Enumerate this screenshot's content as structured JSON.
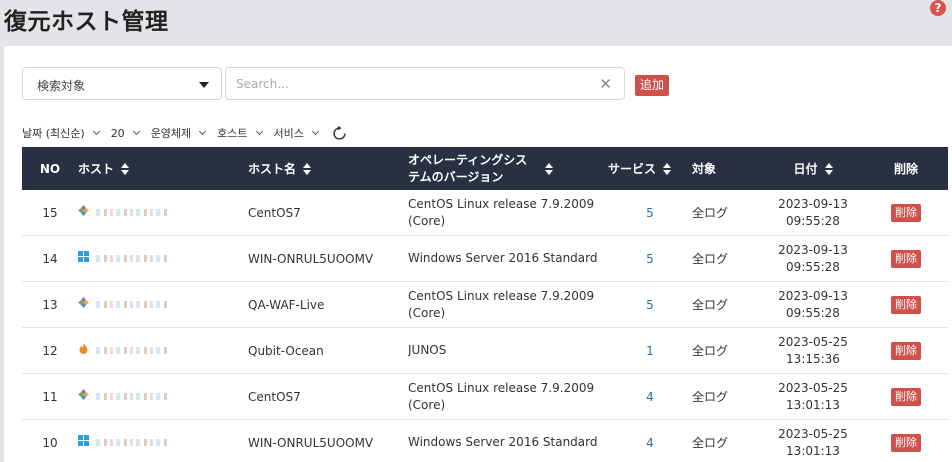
{
  "header": {
    "title": "復元ホスト管理",
    "help_icon": "question-circle-icon"
  },
  "toolbar": {
    "search_target_label": "検索対象",
    "search_placeholder": "Search...",
    "add_label": "追加"
  },
  "filters": [
    "날짜 (최신순)",
    "20",
    "운영체제",
    "호스트",
    "서비스"
  ],
  "table": {
    "headers": {
      "no": "NO",
      "host": "ホスト",
      "host_name": "ホスト名",
      "os": "オペレーティングシステムのバージョン",
      "services": "サービス",
      "target": "対象",
      "date": "日付",
      "delete": "削除"
    },
    "rows": [
      {
        "no": "15",
        "os_icon": "linux-icon",
        "host_name": "CentOS7",
        "os": "CentOS Linux release 7.9.2009 (Core)",
        "services": "5",
        "target": "全ログ",
        "date": "2023-09-13",
        "time": "09:55:28",
        "delete": "削除"
      },
      {
        "no": "14",
        "os_icon": "windows-icon",
        "host_name": "WIN-ONRUL5UOOMV",
        "os": "Windows Server 2016 Standard",
        "services": "5",
        "target": "全ログ",
        "date": "2023-09-13",
        "time": "09:55:28",
        "delete": "削除"
      },
      {
        "no": "13",
        "os_icon": "linux-icon",
        "host_name": "QA-WAF-Live",
        "os": "CentOS Linux release 7.9.2009 (Core)",
        "services": "5",
        "target": "全ログ",
        "date": "2023-09-13",
        "time": "09:55:28",
        "delete": "削除"
      },
      {
        "no": "12",
        "os_icon": "flame-icon",
        "host_name": "Qubit-Ocean",
        "os": "JUNOS",
        "services": "1",
        "target": "全ログ",
        "date": "2023-05-25",
        "time": "13:15:36",
        "delete": "削除"
      },
      {
        "no": "11",
        "os_icon": "linux-icon",
        "host_name": "CentOS7",
        "os": "CentOS Linux release 7.9.2009 (Core)",
        "services": "4",
        "target": "全ログ",
        "date": "2023-05-25",
        "time": "13:01:13",
        "delete": "削除"
      },
      {
        "no": "10",
        "os_icon": "windows-icon",
        "host_name": "WIN-ONRUL5UOOMV",
        "os": "Windows Server 2016 Standard",
        "services": "4",
        "target": "全ログ",
        "date": "2023-05-25",
        "time": "13:01:13",
        "delete": "削除"
      }
    ]
  },
  "colors": {
    "header_bg": "#293042",
    "danger": "#d0504c",
    "link": "#2a6fa8"
  }
}
